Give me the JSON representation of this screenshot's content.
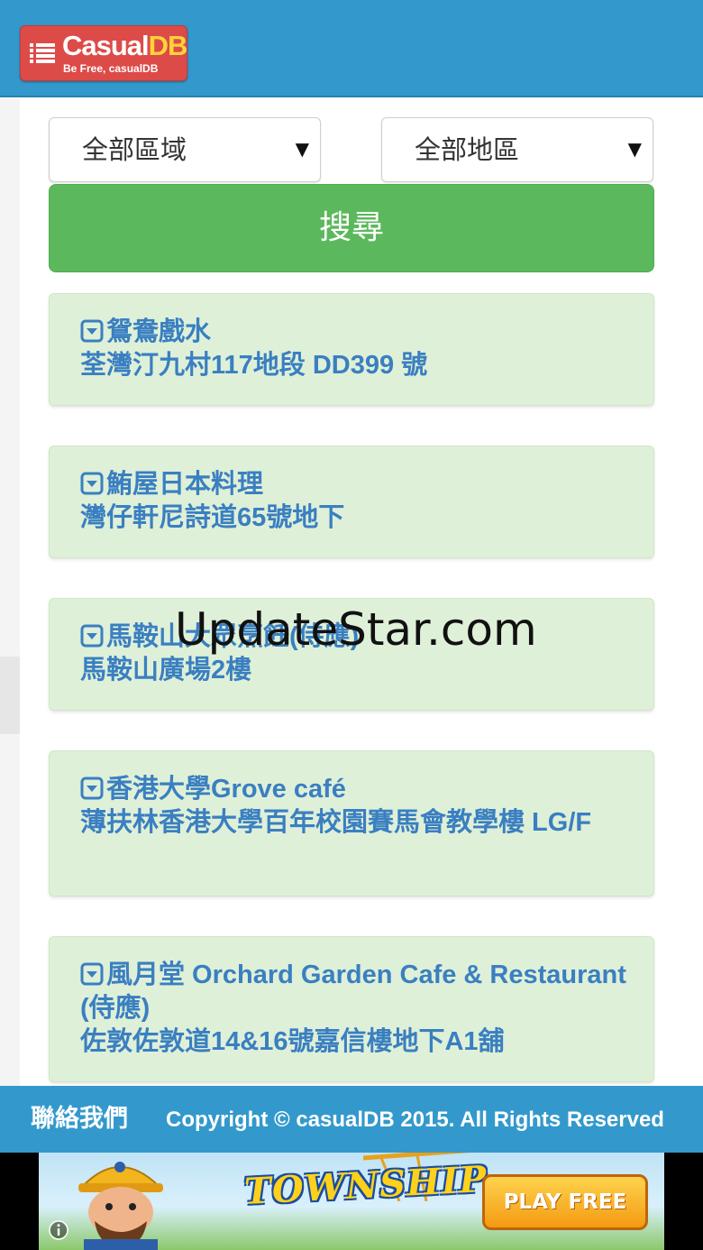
{
  "header": {
    "logo_title_main": "Casual",
    "logo_title_accent": "DB",
    "logo_tagline": "Be Free, casualDB",
    "menu_icon": "menu-list-icon"
  },
  "filters": {
    "region": {
      "selected": "全部區域"
    },
    "district": {
      "selected": "全部地區"
    },
    "search_label": "搜尋"
  },
  "listings": [
    {
      "name": "鴛鴦戲水",
      "address": "荃灣汀九村117地段 DD399 號"
    },
    {
      "name": "鮪屋日本料理",
      "address": "灣仔軒尼詩道65號地下"
    },
    {
      "name": "馬鞍山大眾烹飪(侍應)",
      "address": "馬鞍山廣場2樓"
    },
    {
      "name": "香港大學Grove café",
      "address": "薄扶林香港大學百年校園賽馬會教學樓 LG/F"
    },
    {
      "name": "風月堂 Orchard Garden Cafe & Restaurant (侍應)",
      "address": "佐敦佐敦道14&16號嘉信樓地下A1舖"
    }
  ],
  "footer": {
    "contact_label": "聯絡我們",
    "copyright": "Copyright © casualDB 2015. All Rights Reserved"
  },
  "ad": {
    "title": "TOWNSHIP",
    "cta": "PLAY FREE",
    "info_icon": "info-icon"
  },
  "watermark": "UpdateStar.com",
  "colors": {
    "header_bg": "#3399cc",
    "logo_bg": "#dd4b48",
    "search_button": "#5cb85c",
    "card_bg": "#dff0d8",
    "card_text": "#3a7fc1"
  }
}
